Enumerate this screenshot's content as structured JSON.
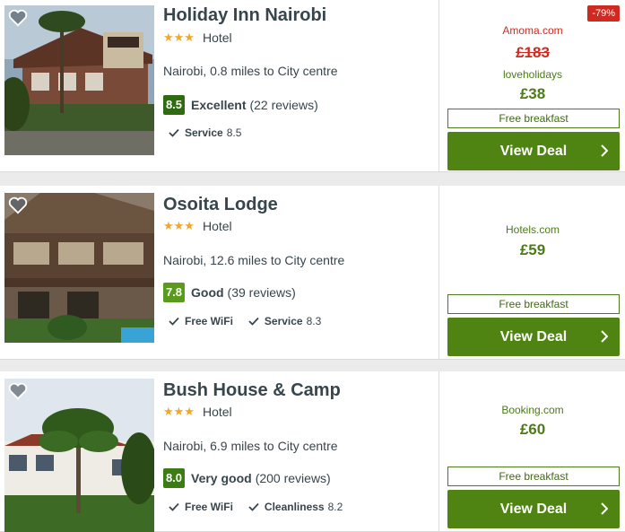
{
  "hotels": [
    {
      "name": "Holiday Inn Nairobi",
      "stars": "★★★",
      "type": "Hotel",
      "location": "Nairobi, 0.8 miles to City centre",
      "score": "8.5",
      "score_color": "#2e6c0f",
      "rating_label": "Excellent",
      "reviews": "(22 reviews)",
      "features": [
        {
          "name": "Service",
          "value": "8.5"
        }
      ],
      "deal": {
        "discount": "-79%",
        "old_provider": "Amoma.com",
        "old_price": "£183",
        "provider": "loveholidays",
        "price": "£38",
        "badge": "Free breakfast",
        "button": "View Deal"
      }
    },
    {
      "name": "Osoita Lodge",
      "stars": "★★★",
      "type": "Hotel",
      "location": "Nairobi, 12.6 miles to City centre",
      "score": "7.8",
      "score_color": "#5a9a1c",
      "rating_label": "Good",
      "reviews": "(39 reviews)",
      "features": [
        {
          "name": "Free WiFi",
          "value": ""
        },
        {
          "name": "Service",
          "value": "8.3"
        }
      ],
      "deal": {
        "provider": "Hotels.com",
        "price": "£59",
        "badge": "Free breakfast",
        "button": "View Deal"
      }
    },
    {
      "name": "Bush House & Camp",
      "stars": "★★★",
      "type": "Hotel",
      "location": "Nairobi, 6.9 miles to City centre",
      "score": "8.0",
      "score_color": "#3b7d12",
      "rating_label": "Very good",
      "reviews": "(200 reviews)",
      "features": [
        {
          "name": "Free WiFi",
          "value": ""
        },
        {
          "name": "Cleanliness",
          "value": "8.2"
        }
      ],
      "deal": {
        "provider": "Booking.com",
        "price": "£60",
        "badge": "Free breakfast",
        "button": "View Deal"
      }
    }
  ],
  "icons": {
    "favorite": "heart-icon",
    "check": "check-icon",
    "chevron": "chevron-right-icon"
  }
}
